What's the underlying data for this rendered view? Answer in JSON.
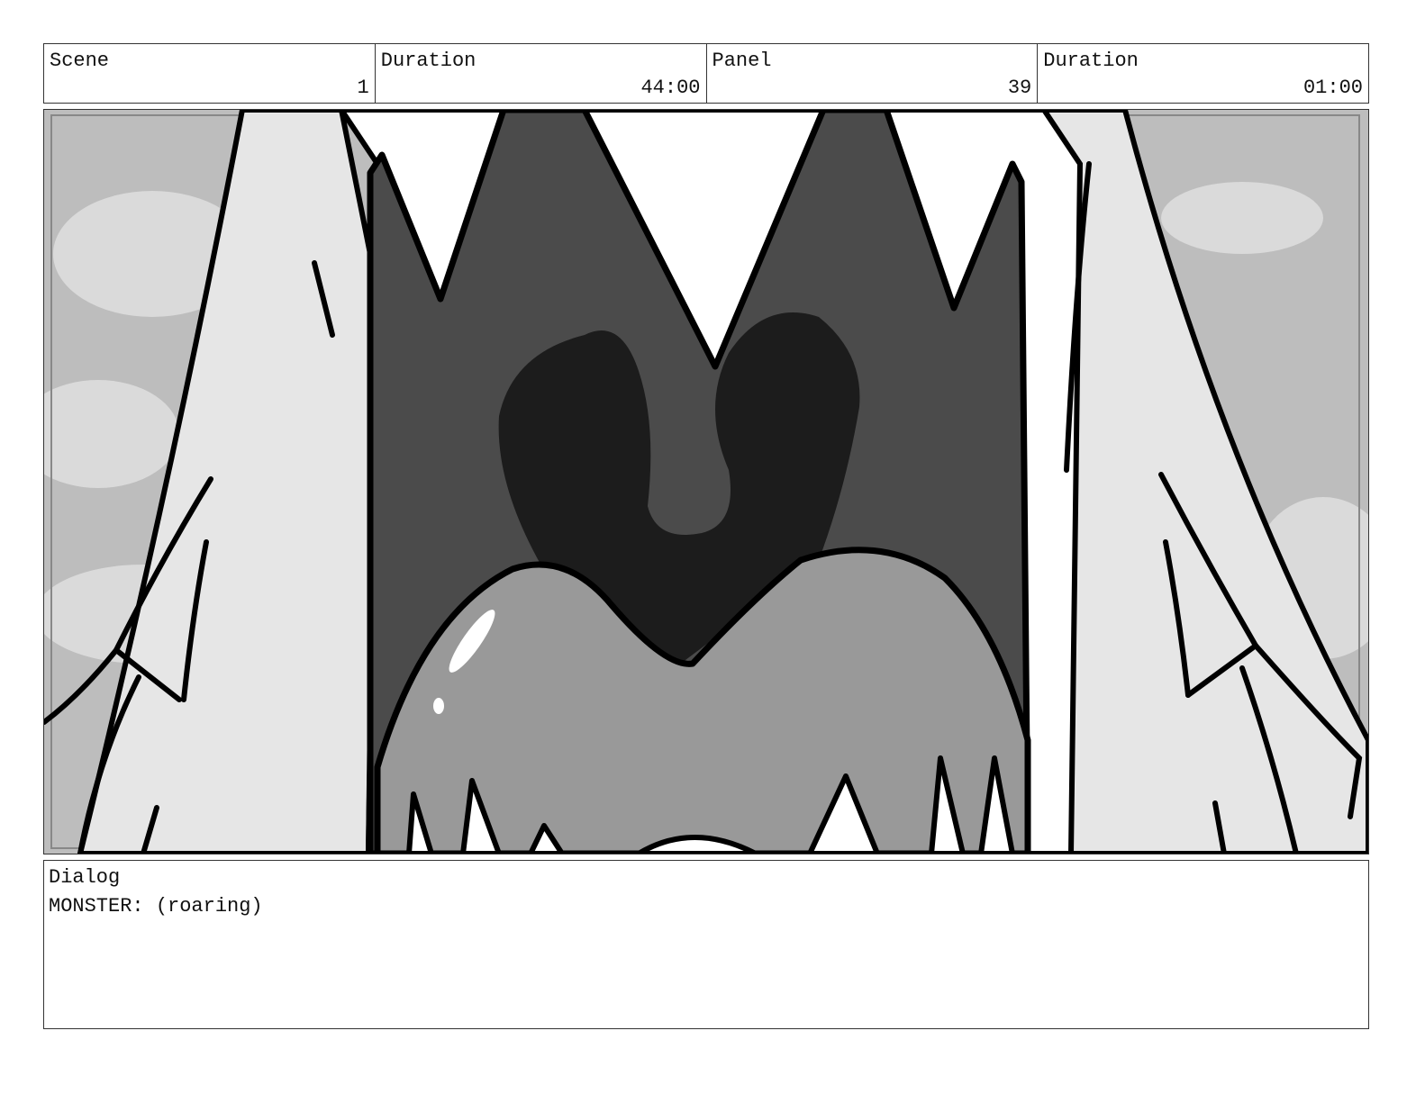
{
  "header": {
    "scene_label": "Scene",
    "scene_value": "1",
    "scene_duration_label": "Duration",
    "scene_duration_value": "44:00",
    "panel_label": "Panel",
    "panel_value": "39",
    "panel_duration_label": "Duration",
    "panel_duration_value": "01:00"
  },
  "dialog": {
    "label": "Dialog",
    "text": "MONSTER: (roaring)"
  },
  "colors": {
    "border": "#333333",
    "sky": "#b8b8b8",
    "cloud": "#dcdcdc",
    "hair": "#e6e6e6",
    "mouth": "#4a4a4a",
    "throat": "#1c1c1c",
    "tongue": "#999999",
    "outline": "#000000"
  }
}
